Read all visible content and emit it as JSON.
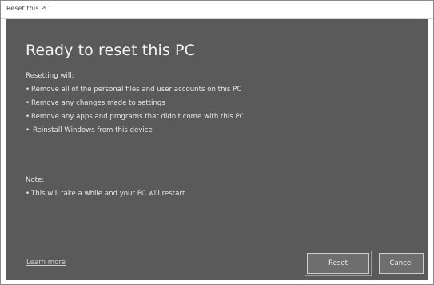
{
  "window": {
    "title": "Reset this PC"
  },
  "dialog": {
    "heading": "Ready to reset this PC",
    "resetting": {
      "label": "Resetting will:",
      "items": [
        "Remove all of the personal files and user accounts on this PC",
        "Remove any changes made to settings",
        "Remove any apps and programs that didn't come with this PC",
        "Reinstall Windows from this device"
      ]
    },
    "note": {
      "label": "Note:",
      "items": [
        "This will take a while and your PC will restart."
      ]
    },
    "learn_more": "Learn more",
    "buttons": {
      "reset": "Reset",
      "cancel": "Cancel"
    }
  },
  "colors": {
    "panel_bg": "#5a5a5a",
    "text": "#e8e8e8",
    "button_bg": "#6e6e6e",
    "button_border": "#cfcfcf"
  }
}
